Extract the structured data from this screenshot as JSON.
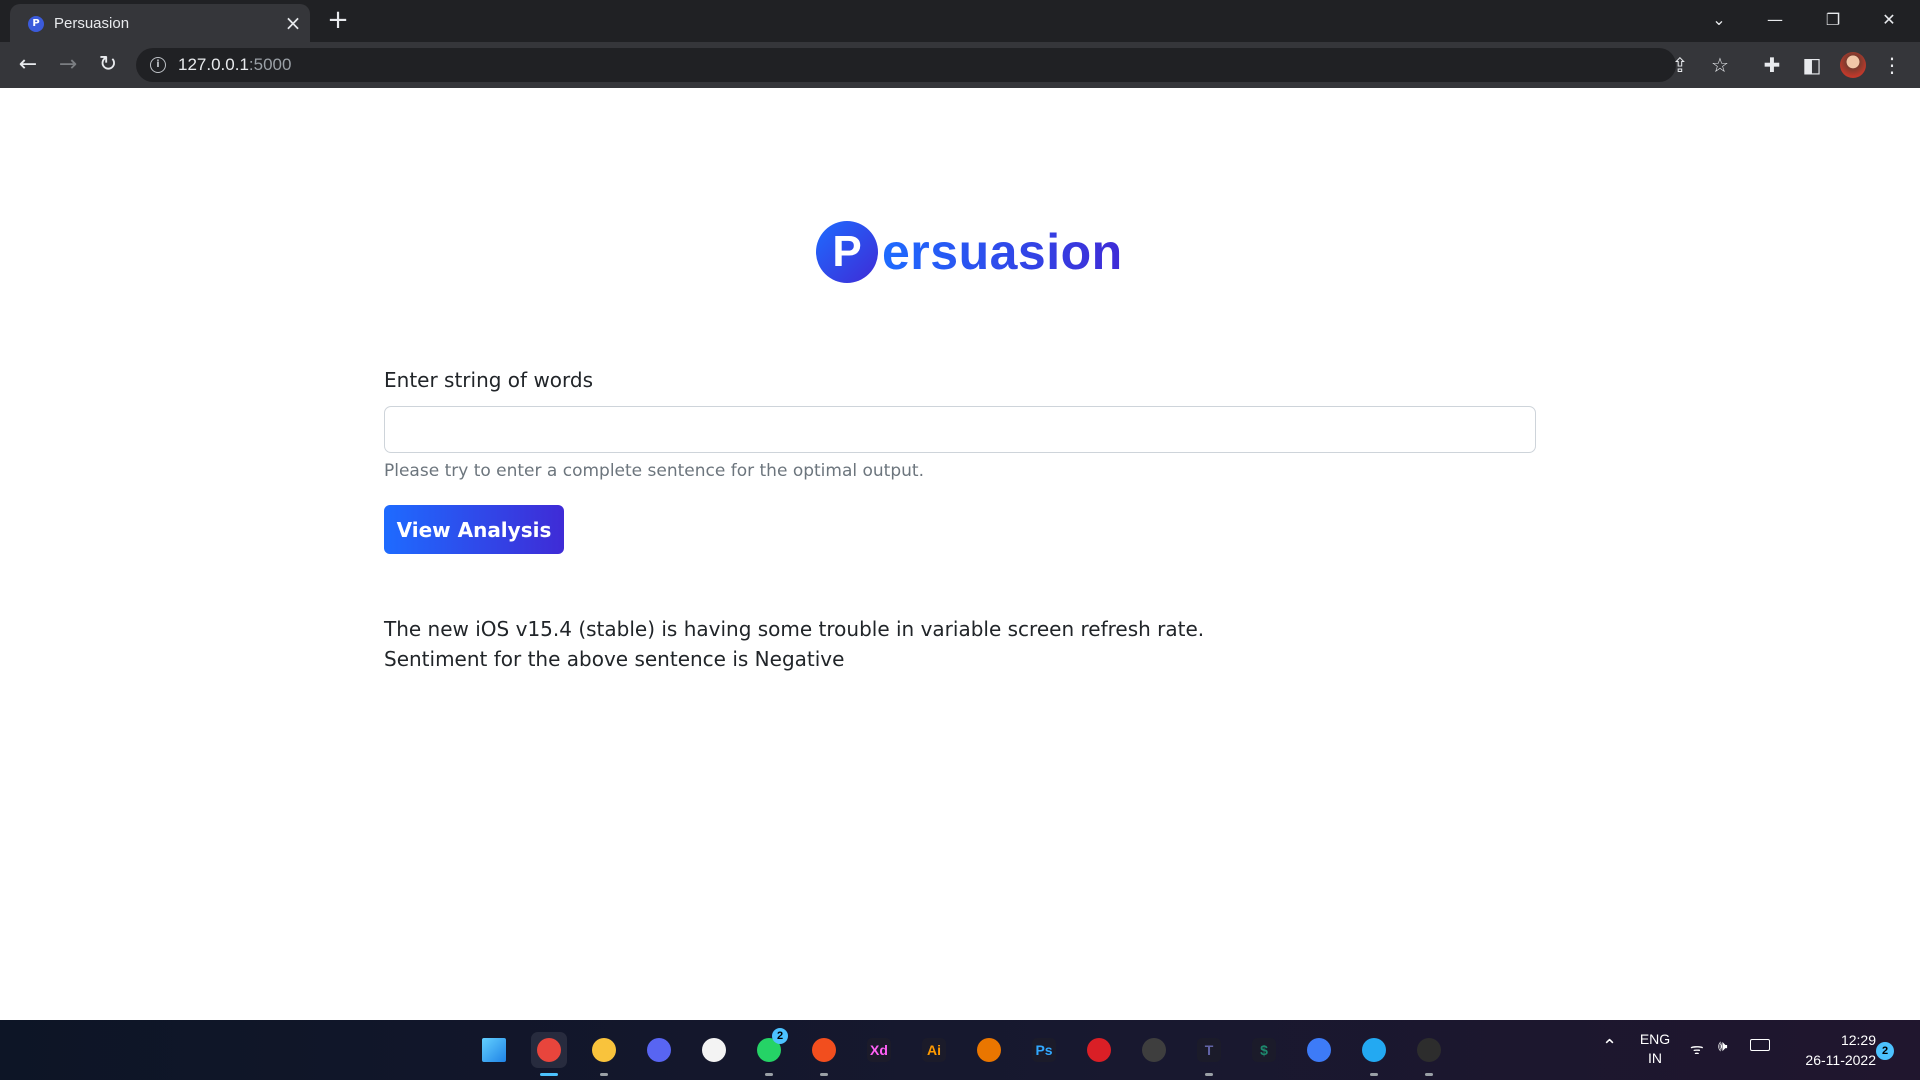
{
  "browser": {
    "tab_title": "Persuasion",
    "tab_favicon_letter": "P",
    "url_host": "127.0.0.1",
    "url_port": ":5000"
  },
  "page": {
    "logo_letter": "P",
    "logo_text": "ersuasion",
    "input_label": "Enter string of words",
    "input_value": "",
    "help_text": "Please try to enter a complete sentence for the optimal output.",
    "button_label": "View Analysis",
    "result_sentence": "The new iOS v15.4 (stable) is having some trouble in variable screen refresh rate.",
    "result_sentiment": "Sentiment for the above sentence is Negative",
    "accent_start": "#1e6bff",
    "accent_end": "#3f2bd6"
  },
  "taskbar": {
    "apps": [
      {
        "name": "start",
        "glyph": "",
        "color": "#4cc2ff"
      },
      {
        "name": "chrome",
        "glyph": "",
        "color": "#e8453c"
      },
      {
        "name": "file-explorer",
        "glyph": "",
        "color": "#f9c33c"
      },
      {
        "name": "discord",
        "glyph": "",
        "color": "#5865f2"
      },
      {
        "name": "microsoft-store",
        "glyph": "",
        "color": "#f3f3f3"
      },
      {
        "name": "whatsapp",
        "glyph": "",
        "color": "#25d366"
      },
      {
        "name": "figma",
        "glyph": "",
        "color": "#f24e1e"
      },
      {
        "name": "adobe-xd",
        "glyph": "Xd",
        "color": "#ff61f6"
      },
      {
        "name": "adobe-illustrator",
        "glyph": "Ai",
        "color": "#ff9a00"
      },
      {
        "name": "blender",
        "glyph": "",
        "color": "#ea7600"
      },
      {
        "name": "photoshop",
        "glyph": "Ps",
        "color": "#31a8ff"
      },
      {
        "name": "creative-cloud",
        "glyph": "",
        "color": "#da1f26"
      },
      {
        "name": "davinci-resolve",
        "glyph": "",
        "color": "#3e3e3e"
      },
      {
        "name": "teams",
        "glyph": "T",
        "color": "#6264a7"
      },
      {
        "name": "dollar-app",
        "glyph": "$",
        "color": "#1e8a6e"
      },
      {
        "name": "search-app",
        "glyph": "",
        "color": "#3d7bf7"
      },
      {
        "name": "vscode",
        "glyph": "",
        "color": "#23a9f2"
      },
      {
        "name": "terminal",
        "glyph": "",
        "color": "#2d2d2d"
      }
    ],
    "whatsapp_badge": "2",
    "language_top": "ENG",
    "language_bottom": "IN",
    "time": "12:29",
    "date": "26-11-2022",
    "notification_count": "2"
  }
}
